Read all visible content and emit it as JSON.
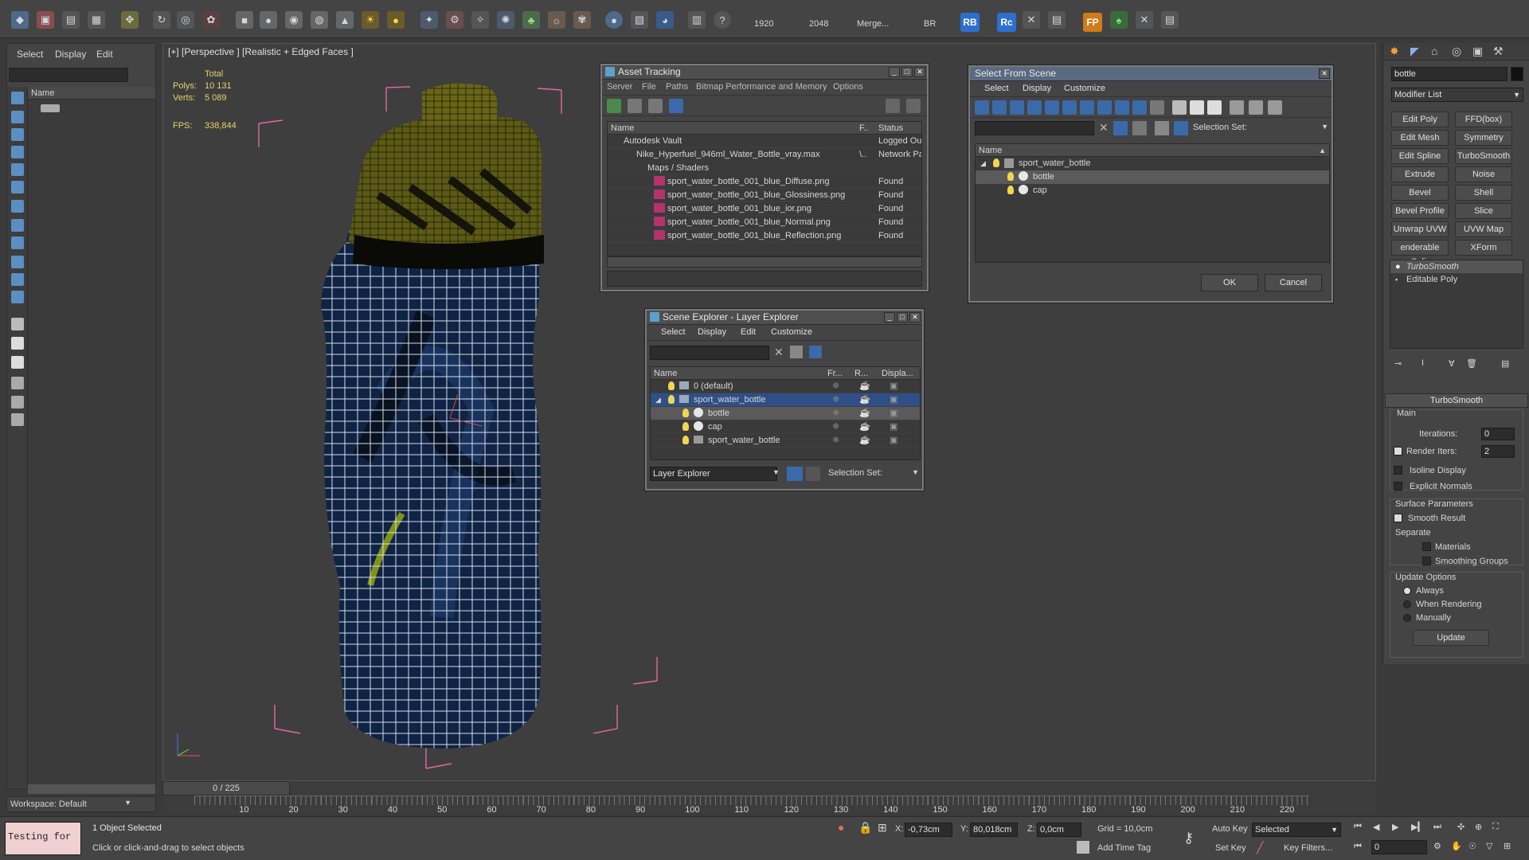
{
  "toolbar": {
    "res_width": "1920",
    "res_height": "2048",
    "merge_label": "Merge...",
    "br_label": "BR",
    "rb_badge": "RB",
    "rc_badge": "Rc",
    "fp_badge": "FP"
  },
  "left_panel": {
    "menu": [
      "Select",
      "Display",
      "Edit"
    ],
    "list_header": "Name",
    "workspace_label": "Workspace: Default"
  },
  "viewport": {
    "label": "[+] [Perspective ] [Realistic + Edged Faces ]",
    "stats": {
      "total_label": "Total",
      "polys_label": "Polys:",
      "polys_value": "10 131",
      "verts_label": "Verts:",
      "verts_value": "5 089",
      "fps_label": "FPS:",
      "fps_value": "338,844"
    }
  },
  "timeline": {
    "slider": "0 / 225",
    "ticks": [
      "10",
      "20",
      "30",
      "40",
      "50",
      "60",
      "70",
      "80",
      "90",
      "100",
      "110",
      "120",
      "130",
      "140",
      "150",
      "160",
      "170",
      "180",
      "190",
      "200",
      "210",
      "220"
    ]
  },
  "asset_tracking": {
    "title": "Asset Tracking",
    "menu": [
      "Server",
      "File",
      "Paths",
      "Bitmap Performance and Memory",
      "Options"
    ],
    "columns": [
      "Name",
      "F..",
      "Status"
    ],
    "rows": [
      {
        "name": "Autodesk Vault",
        "f": "",
        "status": "Logged Out"
      },
      {
        "name": "Nike_Hyperfuel_946ml_Water_Bottle_vray.max",
        "f": "\\..",
        "status": "Network Pa"
      },
      {
        "name": "Maps / Shaders",
        "f": "",
        "status": ""
      },
      {
        "name": "sport_water_bottle_001_blue_Diffuse.png",
        "f": "",
        "status": "Found"
      },
      {
        "name": "sport_water_bottle_001_blue_Glossiness.png",
        "f": "",
        "status": "Found"
      },
      {
        "name": "sport_water_bottle_001_blue_ior.png",
        "f": "",
        "status": "Found"
      },
      {
        "name": "sport_water_bottle_001_blue_Normal.png",
        "f": "",
        "status": "Found"
      },
      {
        "name": "sport_water_bottle_001_blue_Reflection.png",
        "f": "",
        "status": "Found"
      }
    ]
  },
  "select_from_scene": {
    "title": "Select From Scene",
    "menu": [
      "Select",
      "Display",
      "Customize"
    ],
    "selection_set_label": "Selection Set:",
    "name_header": "Name",
    "tree": [
      {
        "label": "sport_water_bottle"
      },
      {
        "label": "bottle"
      },
      {
        "label": "cap"
      }
    ],
    "ok_label": "OK",
    "cancel_label": "Cancel"
  },
  "scene_explorer": {
    "title": "Scene Explorer - Layer Explorer",
    "menu": [
      "Select",
      "Display",
      "Edit",
      "Customize"
    ],
    "columns": [
      "Name",
      "Fr...",
      "R...",
      "Displa..."
    ],
    "rows": [
      {
        "name": "0 (default)"
      },
      {
        "name": "sport_water_bottle"
      },
      {
        "name": "bottle"
      },
      {
        "name": "cap"
      },
      {
        "name": "sport_water_bottle"
      }
    ],
    "footer_dropdown": "Layer Explorer",
    "selection_set_label": "Selection Set:"
  },
  "command_panel": {
    "object_name": "bottle",
    "modifier_list_label": "Modifier List",
    "buttons": [
      "Edit Poly",
      "FFD(box)",
      "Edit Mesh",
      "Symmetry",
      "Edit Spline",
      "TurboSmooth",
      "Extrude",
      "Noise",
      "Bevel",
      "Shell",
      "Bevel Profile",
      "Slice",
      "Unwrap UVW",
      "UVW Map",
      "enderable Splir",
      "XForm"
    ],
    "stack": [
      "TurboSmooth",
      "Editable Poly"
    ],
    "rollout_title": "TurboSmooth",
    "main_label": "Main",
    "iterations_label": "Iterations:",
    "iterations_value": "0",
    "render_iters_label": "Render Iters:",
    "render_iters_value": "2",
    "isoline_label": "Isoline Display",
    "explicit_normals_label": "Explicit Normals",
    "surface_params_label": "Surface Parameters",
    "smooth_result_label": "Smooth Result",
    "separate_label": "Separate",
    "materials_label": "Materials",
    "smoothing_groups_label": "Smoothing Groups",
    "update_options_label": "Update Options",
    "always_label": "Always",
    "when_rendering_label": "When Rendering",
    "manually_label": "Manually",
    "update_button": "Update"
  },
  "statusbar": {
    "objects_selected": "1 Object Selected",
    "prompt": "Click or click-and-drag to select objects",
    "maxscript": "Testing for",
    "x_label": "X:",
    "x_value": "-0,73cm",
    "y_label": "Y:",
    "y_value": "80,018cm",
    "z_label": "Z:",
    "z_value": "0,0cm",
    "grid": "Grid = 10,0cm",
    "add_time_tag": "Add Time Tag",
    "auto_key": "Auto Key",
    "set_key": "Set Key",
    "selected_dropdown": "Selected",
    "key_filters": "Key Filters...",
    "frame_value": "0"
  }
}
